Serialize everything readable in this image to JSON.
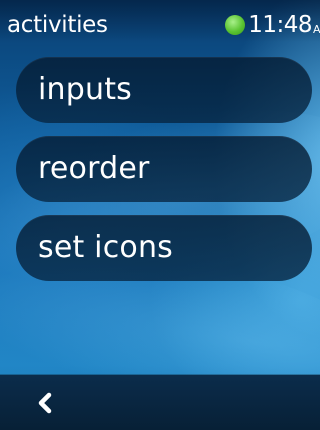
{
  "status_bar": {
    "title": "activities",
    "time": "11:48",
    "time_suffix": "A",
    "status_color": "#5ac432"
  },
  "menu": {
    "items": [
      {
        "label": "inputs"
      },
      {
        "label": "reorder"
      },
      {
        "label": "set icons"
      }
    ]
  },
  "bottom_bar": {
    "back_icon": "chevron-left-icon"
  }
}
